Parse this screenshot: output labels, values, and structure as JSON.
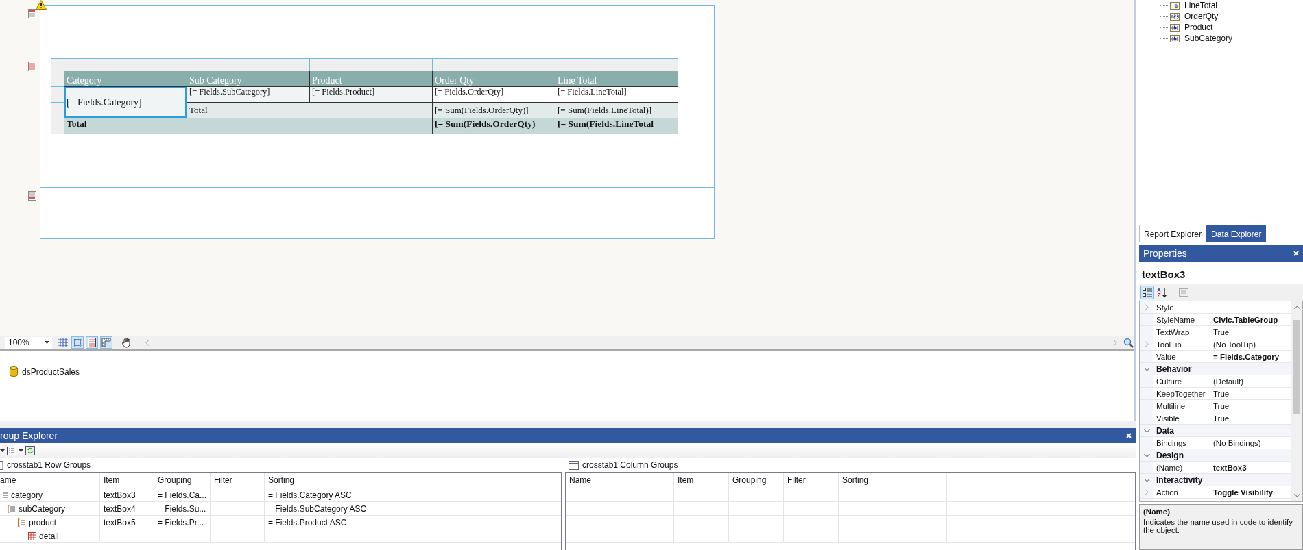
{
  "designer": {
    "crosstab": {
      "rows": [
        {
          "kind": "header",
          "cells": [
            {
              "text": "Category",
              "selected": false
            },
            {
              "text": "Sub Category",
              "selected": false
            },
            {
              "text": "Product",
              "selected": false
            },
            {
              "text": "Order Qty",
              "selected": false
            },
            {
              "text": "Line Total",
              "selected": false
            }
          ]
        },
        {
          "kind": "detail",
          "cells": [
            {
              "text": "[= Fields.Category]",
              "rowspan": 2,
              "selected": true
            },
            {
              "text": "[= Fields.SubCategory]",
              "selected": false
            },
            {
              "text": "[= Fields.Product]",
              "selected": false
            },
            {
              "text": "[= Fields.OrderQty]",
              "selected": false
            },
            {
              "text": "[= Fields.LineTotal]",
              "selected": false
            }
          ]
        },
        {
          "kind": "subtotal",
          "cells": [
            {
              "text": "Total",
              "colspan": 2,
              "selected": false
            },
            {
              "text": "[= Sum(Fields.OrderQty)]",
              "selected": false
            },
            {
              "text": "[= Sum(Fields.LineTotal)]",
              "selected": false
            }
          ]
        },
        {
          "kind": "total",
          "cells": [
            {
              "text": "Total",
              "colspan": 3,
              "selected": false
            },
            {
              "text": "[= Sum(Fields.OrderQty)",
              "selected": false
            },
            {
              "text": "[= Sum(Fields.LineTotal",
              "selected": false
            }
          ]
        }
      ]
    }
  },
  "zoom": "100%",
  "view_toggles": [
    {
      "kind": "grid",
      "on": false
    },
    {
      "kind": "snap",
      "on": true
    },
    {
      "kind": "bands",
      "on": true
    },
    {
      "kind": "ruler",
      "on": true
    }
  ],
  "data_sources": [
    {
      "name": "dsProductSales"
    }
  ],
  "group_explorer": {
    "title": "roup Explorer",
    "row_groups": {
      "title": "crosstab1 Row Groups",
      "columns": [
        "ame",
        "Item",
        "Grouping",
        "Filter",
        "Sorting"
      ],
      "rows": [
        {
          "name": "category",
          "kind": "group",
          "item": "textBox3",
          "grouping": "= Fields.Ca...",
          "sorting": "= Fields.Category ASC",
          "children": [
            {
              "name": "subCategory",
              "kind": "group",
              "item": "textBox4",
              "grouping": "= Fields.Su...",
              "sorting": "= Fields.SubCategory ASC",
              "children": [
                {
                  "name": "product",
                  "kind": "group",
                  "item": "textBox5",
                  "grouping": "= Fields.Pr...",
                  "sorting": "= Fields.Product ASC",
                  "children": [
                    {
                      "name": "detail",
                      "kind": "detail"
                    }
                  ]
                }
              ]
            }
          ]
        }
      ]
    },
    "column_groups": {
      "title": "crosstab1 Column Groups",
      "columns": [
        "Name",
        "Item",
        "Grouping",
        "Filter",
        "Sorting"
      ]
    }
  },
  "data_explorer": {
    "fields": [
      {
        "name": "LineTotal",
        "kind": "decimal"
      },
      {
        "name": "OrderQty",
        "kind": "number"
      },
      {
        "name": "Product",
        "kind": "text"
      },
      {
        "name": "SubCategory",
        "kind": "text"
      }
    ]
  },
  "explorer_tabs": [
    {
      "label": "Report Explorer",
      "selected": false
    },
    {
      "label": "Data Explorer",
      "selected": true
    }
  ],
  "properties": {
    "title": "Properties",
    "object": "textBox3",
    "rows": [
      {
        "kind": "property",
        "expandable": true,
        "name": "Style"
      },
      {
        "kind": "property",
        "expandable": false,
        "name": "StyleName",
        "value": "Civic.TableGroup",
        "bold": true
      },
      {
        "kind": "property",
        "expandable": false,
        "name": "TextWrap",
        "value": "True",
        "bold": false
      },
      {
        "kind": "property",
        "expandable": true,
        "name": "ToolTip",
        "value": "(No ToolTip)",
        "bold": false
      },
      {
        "kind": "property",
        "expandable": false,
        "name": "Value",
        "value": "= Fields.Category",
        "bold": true
      },
      {
        "kind": "category",
        "name": "Behavior"
      },
      {
        "kind": "property",
        "expandable": false,
        "name": "Culture",
        "value": "(Default)",
        "bold": false
      },
      {
        "kind": "property",
        "expandable": false,
        "name": "KeepTogether",
        "value": "True",
        "bold": false
      },
      {
        "kind": "property",
        "expandable": false,
        "name": "Multiline",
        "value": "True",
        "bold": false
      },
      {
        "kind": "property",
        "expandable": false,
        "name": "Visible",
        "value": "True",
        "bold": false
      },
      {
        "kind": "category",
        "name": "Data"
      },
      {
        "kind": "property",
        "expandable": false,
        "name": "Bindings",
        "value": "(No Bindings)",
        "bold": false
      },
      {
        "kind": "category",
        "name": "Design"
      },
      {
        "kind": "property",
        "expandable": false,
        "name": "(Name)",
        "value": "textBox3",
        "bold": true
      },
      {
        "kind": "category",
        "name": "Interactivity"
      },
      {
        "kind": "property",
        "expandable": true,
        "name": "Action",
        "value": "Toggle Visibility",
        "bold": true
      }
    ],
    "description": {
      "name": "(Name)",
      "text": "Indicates the name used in code to identify the object."
    }
  }
}
